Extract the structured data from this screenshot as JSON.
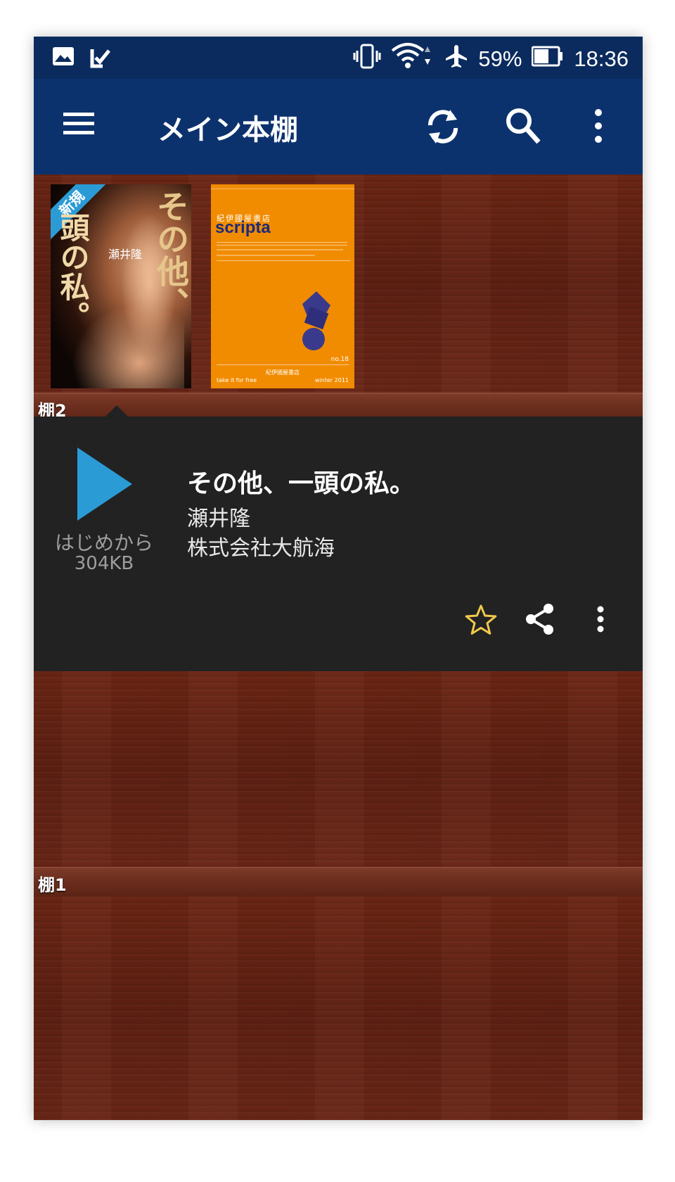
{
  "status_bar": {
    "battery_percent": "59%",
    "time": "18:36",
    "icons": [
      "image-notification-icon",
      "task-check-icon",
      "vibrate-icon",
      "wifi-icon",
      "airplane-icon",
      "battery-icon"
    ]
  },
  "app_bar": {
    "title": "メイン本棚",
    "actions": [
      "sync-icon",
      "search-icon",
      "more-vert-icon"
    ]
  },
  "shelves": [
    {
      "label": "棚2",
      "books": [
        {
          "cover_text": [
            "その他、",
            "頭の私。"
          ],
          "badge": "新規",
          "cover_author": "瀬井隆"
        },
        {
          "publisher_top": "紀伊國屋書店",
          "title": "scripta",
          "issue": "no.18",
          "bottom_left": "take it for free",
          "bottom_center": "紀伊國屋書店",
          "bottom_right": "winter 2011"
        }
      ]
    },
    {
      "label": "棚1",
      "books": []
    }
  ],
  "detail": {
    "play_label": "はじめから",
    "size": "304KB",
    "title": "その他、一頭の私。",
    "author": "瀬井隆",
    "publisher": "株式会社大航海",
    "actions": [
      "star-icon",
      "share-icon",
      "more-vert-icon"
    ]
  },
  "colors": {
    "status_bar": "#0b2b5e",
    "app_bar": "#0c326e",
    "detail_bg": "#222222",
    "play_accent": "#2b9bd6",
    "star": "#f2c94c",
    "scripta_orange": "#f18c00"
  }
}
